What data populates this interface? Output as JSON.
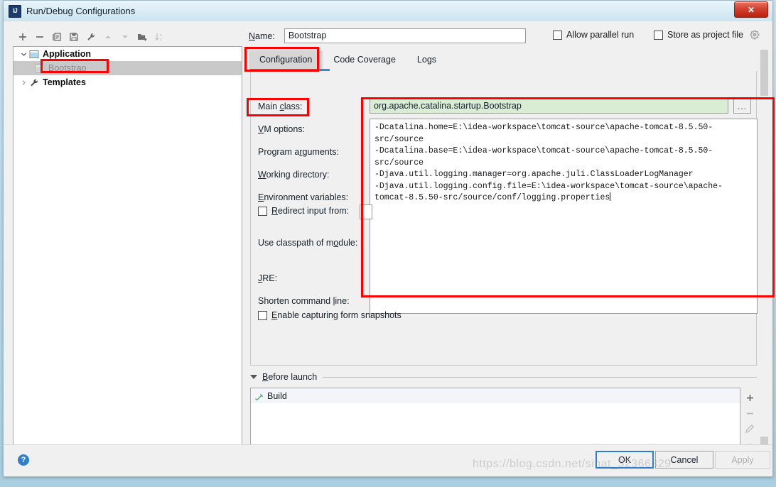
{
  "window": {
    "title": "Run/Debug Configurations",
    "app_icon": "intellij-idea-icon",
    "close_label": "✕"
  },
  "toolbar": {
    "buttons": [
      {
        "name": "add-configuration-button",
        "icon": "plus-icon",
        "label": "+"
      },
      {
        "name": "remove-configuration-button",
        "icon": "minus-icon",
        "label": "−"
      },
      {
        "name": "copy-configuration-button",
        "icon": "copy-icon",
        "label": "⧉"
      },
      {
        "name": "save-configuration-button",
        "icon": "save-icon",
        "label": "💾"
      },
      {
        "name": "edit-templates-button",
        "icon": "wrench-icon",
        "label": "🔧"
      },
      {
        "name": "move-up-button",
        "icon": "arrow-up-icon",
        "label": "▲"
      },
      {
        "name": "move-down-button",
        "icon": "arrow-down-icon",
        "label": "▼"
      },
      {
        "name": "new-folder-button",
        "icon": "folder-add-icon",
        "label": "📁"
      },
      {
        "name": "sort-alphabetically-button",
        "icon": "sort-az-icon",
        "label": "↓az"
      }
    ]
  },
  "tree": {
    "nodes": [
      {
        "label": "Application",
        "icon": "application-icon",
        "twisty": "chevron-down-icon",
        "level": 0,
        "selected": false,
        "bold": true
      },
      {
        "label": "Bootstrap",
        "icon": "application-icon",
        "twisty": "",
        "level": 1,
        "selected": true,
        "bold": false
      },
      {
        "label": "Templates",
        "icon": "wrench-icon",
        "twisty": "chevron-right-icon",
        "level": 0,
        "selected": false,
        "bold": true
      }
    ]
  },
  "header": {
    "name_label": "Name:",
    "name_value": "Bootstrap",
    "name_placeholder": "",
    "allow_parallel_run_label": "Allow parallel run",
    "allow_parallel_run_checked": false,
    "store_as_project_file_label": "Store as project file",
    "store_as_project_file_checked": false,
    "gear_icon": "gear-icon"
  },
  "tabs": [
    {
      "label": "Configuration",
      "active": true
    },
    {
      "label": "Code Coverage",
      "active": false
    },
    {
      "label": "Logs",
      "active": false
    }
  ],
  "configuration": {
    "main_class_label": "Main class:",
    "main_class_value": "org.apache.catalina.startup.Bootstrap",
    "browse_button_label": "...",
    "vm_options_label": "VM options:",
    "vm_options_value": "-Dcatalina.home=E:\\idea-workspace\\tomcat-source\\apache-tomcat-8.5.50-src/source\n-Dcatalina.base=E:\\idea-workspace\\tomcat-source\\apache-tomcat-8.5.50-src/source\n-Djava.util.logging.manager=org.apache.juli.ClassLoaderLogManager\n-Djava.util.logging.config.file=E:\\idea-workspace\\tomcat-source\\apache-tomcat-8.5.50-src/source/conf/logging.properties",
    "program_arguments_label": "Program arguments:",
    "program_arguments_value": "",
    "working_directory_label": "Working directory:",
    "working_directory_value": "",
    "environment_variables_label": "Environment variables:",
    "environment_variables_value": "",
    "redirect_input_from_label": "Redirect input from:",
    "redirect_input_from_checked": false,
    "use_classpath_of_module_label": "Use classpath of module:",
    "jre_label": "JRE:",
    "shorten_command_line_label": "Shorten command line:",
    "enable_capturing_form_snapshots_label": "Enable capturing form snapshots",
    "enable_capturing_form_snapshots_checked": false
  },
  "before_launch": {
    "title": "Before launch",
    "twisty": "triangle-down-icon",
    "items": [
      {
        "label": "Build",
        "icon": "build-hammer-icon"
      }
    ],
    "side_buttons": [
      {
        "name": "before-launch-add-button",
        "icon": "plus-icon"
      },
      {
        "name": "before-launch-remove-button",
        "icon": "minus-icon"
      },
      {
        "name": "before-launch-edit-button",
        "icon": "pencil-icon"
      },
      {
        "name": "before-launch-move-up-button",
        "icon": "arrow-up-icon"
      },
      {
        "name": "before-launch-move-down-button",
        "icon": "arrow-down-icon"
      }
    ]
  },
  "footer": {
    "help_label": "?",
    "ok_label": "OK",
    "cancel_label": "Cancel",
    "apply_label": "Apply",
    "apply_enabled": false
  },
  "watermark": "https://blog.csdn.net/sinat_32366329",
  "colors": {
    "accent_blue": "#3a85d6",
    "annotation_red": "#fb0000",
    "valid_field_green": "#d9ecd4",
    "selection_gray": "#c9c9c9"
  }
}
